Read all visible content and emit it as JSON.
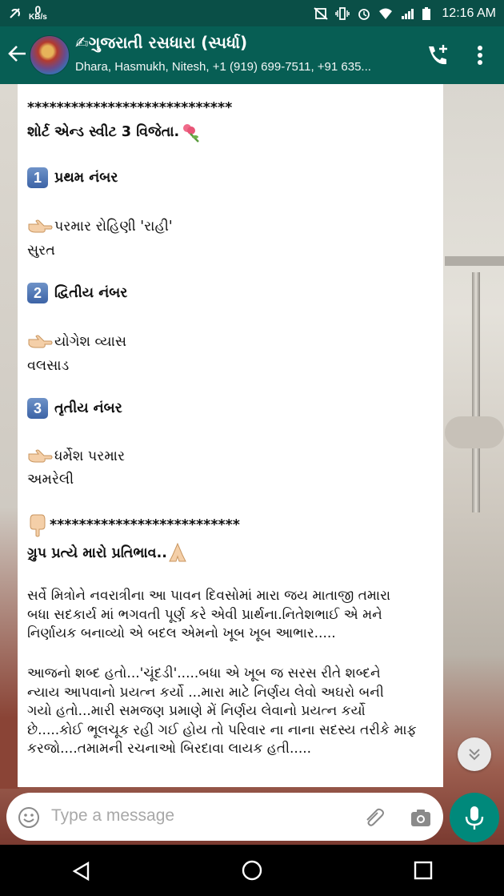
{
  "status_bar": {
    "speed_value": "0",
    "speed_unit": "KB/s",
    "time": "12:16 AM"
  },
  "header": {
    "title": "✍ગુજરાતી રસધારા (સ્પર્ધા)",
    "subtitle": "Dhara, Hasmukh, Nitesh, +1 (919) 699-7511, +91 635..."
  },
  "message": {
    "stars_top": "****************************",
    "heading": "શોર્ટ એન્ડ સ્વીટ 3 વિજેતા.",
    "place1_num": "1",
    "place1_label": "પ્રથમ નંબર",
    "place1_name": "પરમાર રોહિણી 'રાહી'",
    "place1_city": "સુરત",
    "place2_num": "2",
    "place2_label": "દ્વિતીય નંબર",
    "place2_name": "યોગેશ વ્યાસ",
    "place2_city": "વલસાડ",
    "place3_num": "3",
    "place3_label": "તૃતીય નંબર",
    "place3_name": "ધર્મેશ પરમાર",
    "place3_city": "અમરેલી",
    "stars_bottom": "**************************",
    "response_heading": "ગ્રુપ પ્રત્યે મારો પ્રતિભાવ..",
    "para1_line1": "સર્વે મિત્રોને નવરાત્રીના આ પાવન દિવસોમાં મારા જય માતાજી તમારા",
    "para1_line2": "બધા સદકાર્ય માં ભગવતી પૂર્ણ કરે એવી પ્રાર્થના.નિતેશભાઈ એ મને",
    "para1_line3": "નિર્ણાયક બનાવ્યો એ બદલ એમનો ખૂબ ખૂબ આભાર.....",
    "para2_line1": "આજનો શબ્દ હતો...'ચૂંદડી'.....બધા એ ખૂબ જ સરસ રીતે શબ્દને",
    "para2_line2": "ન્યાય આપવાનો પ્રયત્ન કર્યો ...મારા માટે નિર્ણય લેવો અઘરો બની",
    "para2_line3": "ગયો હતો...મારી સમજણ પ્રમાણે મેં નિર્ણય લેવાનો પ્રયત્ન કર્યો",
    "para2_line4": "છે.....કોઈ ભૂલચૂક રહી ગઈ હોય તો પરિવાર ના નાના સદસ્ય તરીકે માફ",
    "para2_line5": "કરજો....તમામની રચનાઓ બિરદાવા લાયક હતી....."
  },
  "input": {
    "placeholder": "Type a message"
  },
  "colors": {
    "header": "#075e54",
    "status": "#0a4f47",
    "accent": "#00897b"
  },
  "icons": [
    "back-arrow-icon",
    "call-add-icon",
    "more-vert-icon",
    "emoji-icon",
    "attach-icon",
    "camera-icon",
    "mic-icon",
    "chevron-double-down-icon",
    "nav-back-icon",
    "nav-home-icon",
    "nav-recent-icon",
    "point-right-icon",
    "point-down-icon",
    "pray-icon",
    "flower-icon",
    "wifi-icon",
    "signal-icon",
    "battery-icon",
    "alarm-icon",
    "vibrate-icon",
    "no-sim-icon",
    "data-saver-icon"
  ]
}
